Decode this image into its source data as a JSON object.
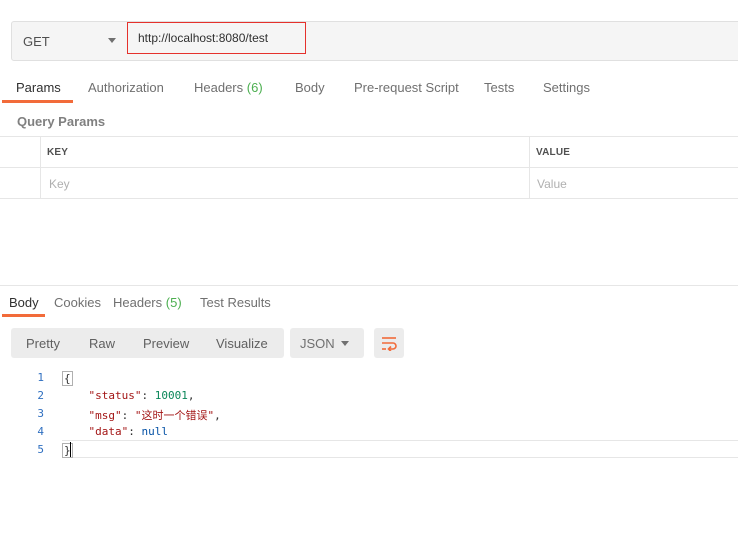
{
  "request": {
    "method": "GET",
    "url": "http://localhost:8080/test"
  },
  "request_tabs": [
    {
      "label": "Params",
      "active": true
    },
    {
      "label": "Authorization"
    },
    {
      "label": "Headers",
      "count": "(6)"
    },
    {
      "label": "Body"
    },
    {
      "label": "Pre-request Script"
    },
    {
      "label": "Tests"
    },
    {
      "label": "Settings"
    }
  ],
  "query_params": {
    "title": "Query Params",
    "columns": [
      "KEY",
      "VALUE"
    ],
    "placeholders": {
      "key": "Key",
      "value": "Value"
    }
  },
  "response_tabs": [
    {
      "label": "Body",
      "active": true
    },
    {
      "label": "Cookies"
    },
    {
      "label": "Headers",
      "count": "(5)"
    },
    {
      "label": "Test Results"
    }
  ],
  "response_toolbar": {
    "views": [
      "Pretty",
      "Raw",
      "Preview",
      "Visualize"
    ],
    "format": "JSON",
    "wrap_icon": "wrap-lines-icon"
  },
  "response_body": {
    "line_numbers": [
      "1",
      "2",
      "3",
      "4",
      "5"
    ],
    "open_brace": "{",
    "close_brace": "}",
    "fields": [
      {
        "key": "\"status\"",
        "value": "10001",
        "type": "number"
      },
      {
        "key": "\"msg\"",
        "value": "\"这时一个错误\"",
        "type": "string"
      },
      {
        "key": "\"data\"",
        "value": "null",
        "type": "null"
      }
    ]
  },
  "colors": {
    "accent": "#f26b3a",
    "count_green": "#4caf50",
    "url_highlight": "#e5312c"
  }
}
